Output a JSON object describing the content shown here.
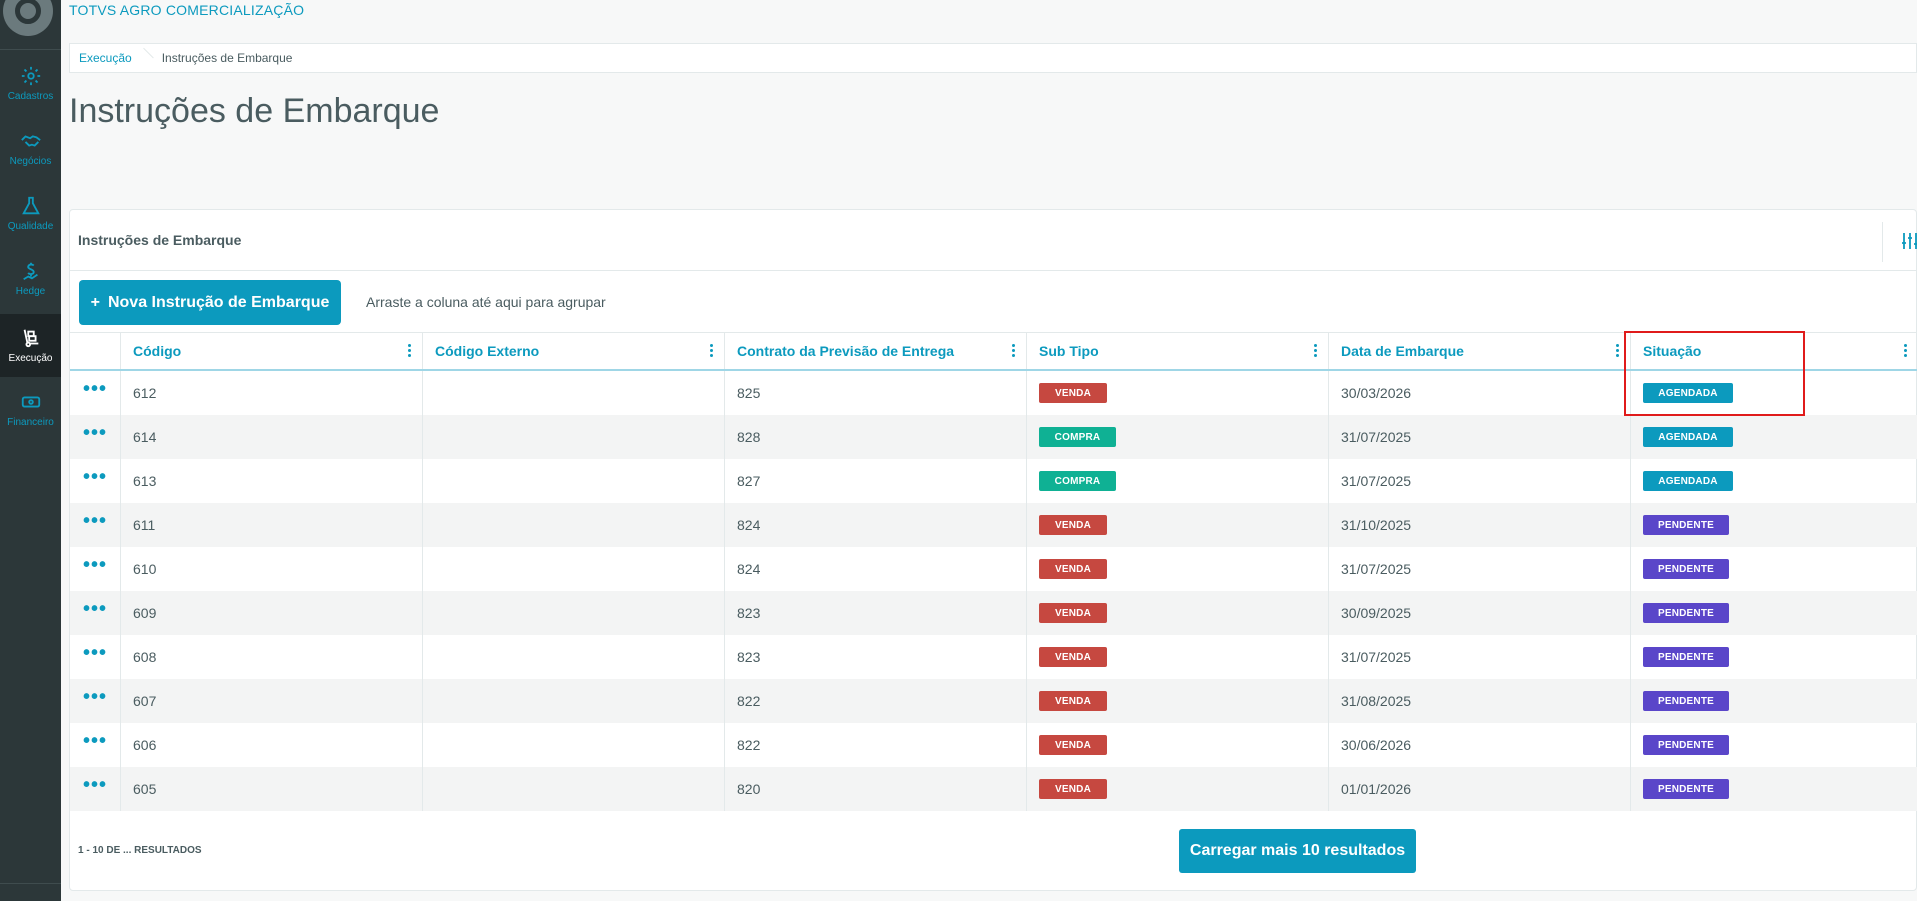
{
  "app": {
    "brand": "TOTVS AGRO COMERCIALIZAÇÃO"
  },
  "sidebar": {
    "items": [
      {
        "label": "Cadastros",
        "icon": "gear-icon"
      },
      {
        "label": "Negócios",
        "icon": "handshake-icon"
      },
      {
        "label": "Qualidade",
        "icon": "flask-icon"
      },
      {
        "label": "Hedge",
        "icon": "dollar-chart-icon"
      },
      {
        "label": "Execução",
        "icon": "hand-truck-icon",
        "active": true
      },
      {
        "label": "Financeiro",
        "icon": "money-icon"
      }
    ]
  },
  "breadcrumb": {
    "parent": "Execução",
    "current": "Instruções de Embarque"
  },
  "page": {
    "title": "Instruções de Embarque"
  },
  "card": {
    "title": "Instruções de Embarque",
    "new_button": "Nova Instrução de Embarque",
    "new_button_icon": "+",
    "group_hint": "Arraste a coluna até aqui para agrupar"
  },
  "table": {
    "columns": [
      "Código",
      "Código Externo",
      "Contrato da Previsão de Entrega",
      "Sub Tipo",
      "Data de Embarque",
      "Situação"
    ],
    "row_action_glyph": "•••",
    "rows": [
      {
        "codigo": "612",
        "externo": "",
        "contrato": "825",
        "subtipo": "VENDA",
        "data": "30/03/2026",
        "situacao": "AGENDADA"
      },
      {
        "codigo": "614",
        "externo": "",
        "contrato": "828",
        "subtipo": "COMPRA",
        "data": "31/07/2025",
        "situacao": "AGENDADA"
      },
      {
        "codigo": "613",
        "externo": "",
        "contrato": "827",
        "subtipo": "COMPRA",
        "data": "31/07/2025",
        "situacao": "AGENDADA"
      },
      {
        "codigo": "611",
        "externo": "",
        "contrato": "824",
        "subtipo": "VENDA",
        "data": "31/10/2025",
        "situacao": "PENDENTE"
      },
      {
        "codigo": "610",
        "externo": "",
        "contrato": "824",
        "subtipo": "VENDA",
        "data": "31/07/2025",
        "situacao": "PENDENTE"
      },
      {
        "codigo": "609",
        "externo": "",
        "contrato": "823",
        "subtipo": "VENDA",
        "data": "30/09/2025",
        "situacao": "PENDENTE"
      },
      {
        "codigo": "608",
        "externo": "",
        "contrato": "823",
        "subtipo": "VENDA",
        "data": "31/07/2025",
        "situacao": "PENDENTE"
      },
      {
        "codigo": "607",
        "externo": "",
        "contrato": "822",
        "subtipo": "VENDA",
        "data": "31/08/2025",
        "situacao": "PENDENTE"
      },
      {
        "codigo": "606",
        "externo": "",
        "contrato": "822",
        "subtipo": "VENDA",
        "data": "30/06/2026",
        "situacao": "PENDENTE"
      },
      {
        "codigo": "605",
        "externo": "",
        "contrato": "820",
        "subtipo": "VENDA",
        "data": "01/01/2026",
        "situacao": "PENDENTE"
      }
    ]
  },
  "footer": {
    "count": "1 - 10 DE ... RESULTADOS",
    "load_more": "Carregar mais 10 resultados"
  },
  "colors": {
    "primary": "#0c9abe",
    "venda": "#c64840",
    "compra": "#0fb194",
    "agendada": "#0c9abe",
    "pendente": "#5a46c9",
    "sidebar": "#2c3739",
    "highlight": "#e01b1b"
  }
}
